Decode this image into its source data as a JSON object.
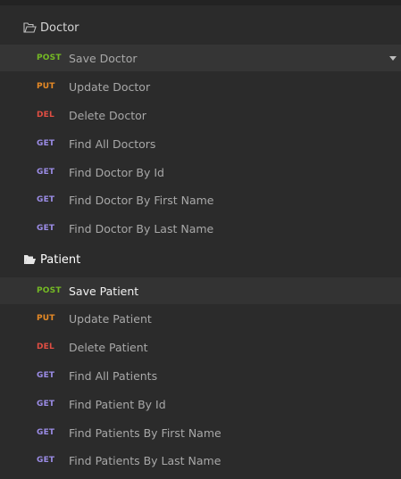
{
  "folders": [
    {
      "name": "Doctor",
      "requests": [
        {
          "method": "POST",
          "label": "Save Doctor"
        },
        {
          "method": "PUT",
          "label": "Update Doctor"
        },
        {
          "method": "DEL",
          "label": "Delete Doctor"
        },
        {
          "method": "GET",
          "label": "Find All Doctors"
        },
        {
          "method": "GET",
          "label": "Find Doctor By Id"
        },
        {
          "method": "GET",
          "label": "Find Doctor By First Name"
        },
        {
          "method": "GET",
          "label": "Find Doctor By Last Name"
        }
      ]
    },
    {
      "name": "Patient",
      "requests": [
        {
          "method": "POST",
          "label": "Save Patient"
        },
        {
          "method": "PUT",
          "label": "Update Patient"
        },
        {
          "method": "DEL",
          "label": "Delete Patient"
        },
        {
          "method": "GET",
          "label": "Find All Patients"
        },
        {
          "method": "GET",
          "label": "Find Patient By Id"
        },
        {
          "method": "GET",
          "label": "Find Patients By First Name"
        },
        {
          "method": "GET",
          "label": "Find Patients By Last Name"
        }
      ]
    }
  ],
  "icons": {
    "folder": "folder-open-icon",
    "dropdown": "chevron-down-icon"
  },
  "colors": {
    "post": "#75ba24",
    "put": "#e78a25",
    "del": "#e14e43",
    "get": "#9b8ce6"
  }
}
